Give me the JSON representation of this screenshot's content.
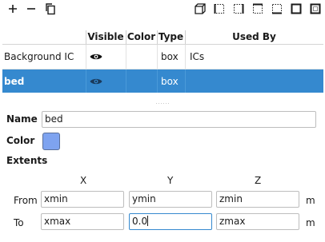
{
  "toolbar": {
    "left": [
      {
        "icon": "plus-icon",
        "glyph": "+"
      },
      {
        "icon": "minus-icon",
        "glyph": "−"
      },
      {
        "icon": "copy-icon"
      }
    ],
    "right": [
      "box-3d-icon",
      "face-left-icon",
      "face-right-icon",
      "face-top-icon",
      "face-bottom-icon",
      "face-front-icon",
      "face-back-icon"
    ]
  },
  "table": {
    "columns": [
      "",
      "Visible",
      "Color",
      "Type",
      "Used By"
    ],
    "rows": [
      {
        "name": "Background IC",
        "visible_icon": "eye-icon",
        "type": "box",
        "used_by": "ICs",
        "selected": false
      },
      {
        "name": "bed",
        "visible_icon": "eye-icon",
        "type": "box",
        "used_by": "",
        "selected": true
      }
    ]
  },
  "form": {
    "name_label": "Name",
    "name_value": "bed",
    "color_label": "Color",
    "color_value": "#7ea3f0",
    "extents_label": "Extents",
    "axes": [
      "X",
      "Y",
      "Z"
    ],
    "from_label": "From",
    "to_label": "To",
    "from": [
      "xmin",
      "ymin",
      "zmin"
    ],
    "to": [
      "xmax",
      "0.0",
      "zmax"
    ],
    "unit": "m"
  },
  "colors": {
    "selection": "#3589cf",
    "focus_border": "#3589cf"
  }
}
